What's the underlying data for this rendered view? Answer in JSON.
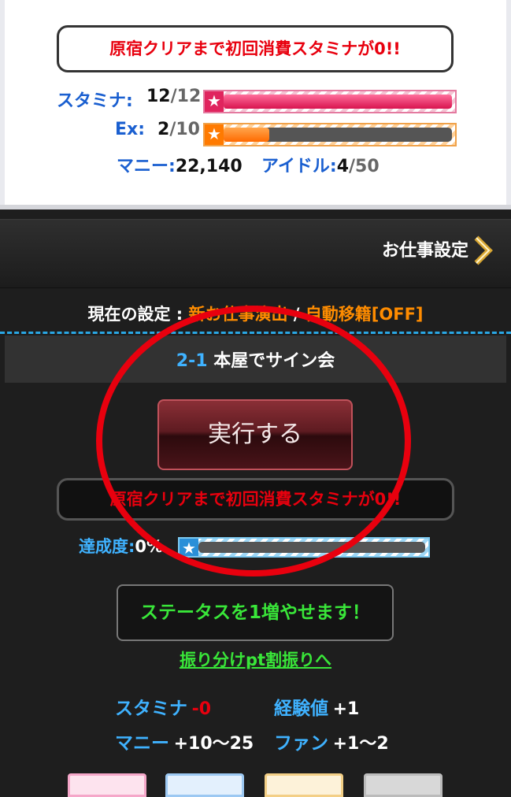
{
  "status": {
    "notice": "原宿クリアまで初回消費スタミナが0!!",
    "stamina_label": "スタミナ:",
    "stamina_current": "12",
    "stamina_max": "/12",
    "stamina_fraction": 1.0,
    "ex_label": "Ex:",
    "ex_current": "2",
    "ex_max": "/10",
    "ex_fraction": 0.2,
    "money_label": "マニー:",
    "money_value": "22,140",
    "idol_label": "アイドル:",
    "idol_current": "4",
    "idol_max": "/50",
    "star_glyph": "★"
  },
  "settings": {
    "link_label": "お仕事設定",
    "current_prefix": "現在の設定 : ",
    "option1": "新お仕事演出",
    "separator": " / ",
    "option2": "自動移籍[OFF]"
  },
  "job": {
    "number": "2-1",
    "title": " 本屋でサイン会",
    "execute_label": "実行する",
    "notice": "原宿クリアまで初回消費スタミナが0!!",
    "achievement_label": "達成度:",
    "achievement_value": "0%",
    "achievement_fraction": 0.0
  },
  "status_up": {
    "message": "ステータスを1増やせます！",
    "link": "振り分けpt割振りへ"
  },
  "rewards": {
    "stamina_label": "スタミナ",
    "stamina_value": "-0",
    "exp_label": "経験値",
    "exp_value": "+1",
    "money_label": "マニー",
    "money_value": "+10〜25",
    "fan_label": "ファン",
    "fan_value": "+1〜2"
  },
  "colors": {
    "stamina_bar": "#e0245e",
    "ex_bar": "#ff7a00",
    "annotation_circle": "#e8000e"
  }
}
